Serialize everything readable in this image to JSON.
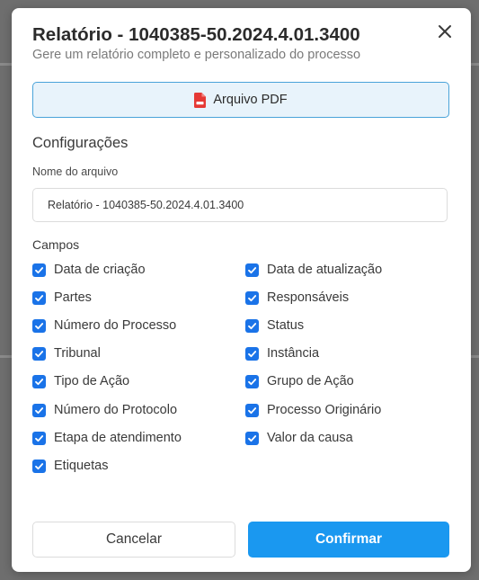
{
  "dialog": {
    "title": "Relatório - 1040385-50.2024.4.01.3400",
    "subtitle": "Gere um relatório completo e personalizado do processo"
  },
  "icons": {
    "close": "close-icon",
    "pdf": "pdf-file-icon",
    "check": "checkmark-icon"
  },
  "format_button": {
    "label": "Arquivo PDF"
  },
  "settings": {
    "title": "Configurações",
    "filename_label": "Nome do arquivo",
    "filename_value": "Relatório - 1040385-50.2024.4.01.3400"
  },
  "fields": {
    "title": "Campos",
    "left": [
      {
        "label": "Data de criação",
        "checked": true
      },
      {
        "label": "Partes",
        "checked": true
      },
      {
        "label": "Número do Processo",
        "checked": true
      },
      {
        "label": "Tribunal",
        "checked": true
      },
      {
        "label": "Tipo de Ação",
        "checked": true
      },
      {
        "label": "Número do Protocolo",
        "checked": true
      },
      {
        "label": "Etapa de atendimento",
        "checked": true
      },
      {
        "label": "Etiquetas",
        "checked": true
      }
    ],
    "right": [
      {
        "label": "Data de atualização",
        "checked": true
      },
      {
        "label": "Responsáveis",
        "checked": true
      },
      {
        "label": "Status",
        "checked": true
      },
      {
        "label": "Instância",
        "checked": true
      },
      {
        "label": "Grupo de Ação",
        "checked": true
      },
      {
        "label": "Processo Originário",
        "checked": true
      },
      {
        "label": "Valor da causa",
        "checked": true
      }
    ]
  },
  "footer": {
    "cancel_label": "Cancelar",
    "confirm_label": "Confirmar"
  },
  "colors": {
    "accent": "#1a98f0",
    "checkbox": "#1a73e8",
    "pdf_icon": "#e53935",
    "format_button_bg": "#e8f3fb",
    "format_button_border": "#4aa3d9"
  }
}
